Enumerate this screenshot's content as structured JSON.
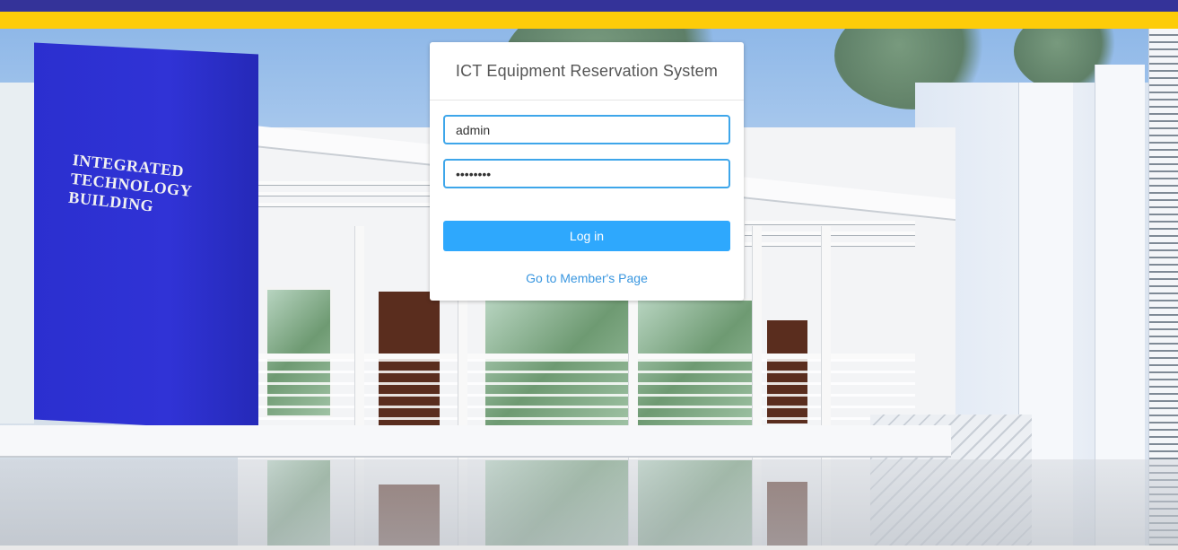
{
  "header": {
    "stripe_colors": {
      "blue": "#343399",
      "yellow": "#fdcc09"
    }
  },
  "background": {
    "building_sign": "INTEGRATED\nTECHNOLOGY\nBUILDING"
  },
  "login": {
    "title": "ICT Equipment Reservation System",
    "username_value": "admin",
    "password_value": "password",
    "login_button": "Log in",
    "member_link": "Go to Member's Page",
    "accent_color": "#2ea8fd",
    "field_border_color": "#3ea6ea"
  }
}
